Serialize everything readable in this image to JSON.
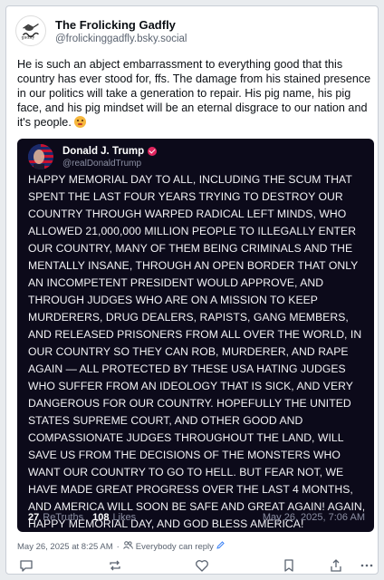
{
  "author": {
    "display_name": "The Frolicking Gadfly",
    "handle": "@frolickinggadfly.bsky.social",
    "avatar_icon": "gadfly-logo"
  },
  "post": {
    "text": "He is such an abject embarrassment to everything good that this country has ever stood for, ffs. The damage from his stained presence in our politics will take a generation to repair. His pig name, his pig face, and his pig mindset will be an eternal disgrace to our nation and it's people.",
    "emoji": "grimacing-face"
  },
  "quote": {
    "display_name": "Donald J. Trump",
    "handle": "@realDonaldTrump",
    "text": "HAPPY MEMORIAL DAY TO ALL, INCLUDING THE SCUM THAT SPENT THE LAST FOUR YEARS TRYING TO DESTROY OUR COUNTRY THROUGH WARPED RADICAL LEFT MINDS, WHO ALLOWED 21,000,000 MILLION PEOPLE TO ILLEGALLY ENTER OUR COUNTRY, MANY OF THEM BEING CRIMINALS AND THE MENTALLY INSANE, THROUGH AN OPEN BORDER THAT ONLY AN INCOMPETENT PRESIDENT WOULD APPROVE, AND THROUGH JUDGES WHO ARE ON A MISSION TO KEEP MURDERERS, DRUG DEALERS, RAPISTS, GANG MEMBERS, AND RELEASED PRISONERS FROM ALL OVER THE WORLD, IN OUR COUNTRY SO THEY CAN ROB, MURDERER, AND RAPE AGAIN — ALL PROTECTED BY THESE USA HATING JUDGES WHO SUFFER FROM AN IDEOLOGY THAT IS SICK, AND VERY DANGEROUS FOR OUR COUNTRY. HOPEFULLY THE UNITED STATES SUPREME COURT, AND OTHER GOOD AND COMPASSIONATE JUDGES THROUGHOUT THE LAND, WILL SAVE US FROM THE DECISIONS OF THE MONSTERS WHO WANT OUR COUNTRY TO GO TO HELL. BUT FEAR NOT, WE HAVE MADE GREAT PROGRESS OVER THE LAST 4 MONTHS, AND AMERICA WILL SOON BE SAFE AND GREAT AGAIN! AGAIN, HAPPY MEMORIAL DAY, AND GOD BLESS AMERICA!",
    "retruths_count": "27",
    "retruths_label": "ReTruths",
    "likes_count": "108",
    "likes_label": "Likes",
    "date": "May 26, 2025, 7:06 AM"
  },
  "meta": {
    "timestamp": "May 26, 2025 at 8:25 AM",
    "separator": "·",
    "reply_setting": "Everybody can reply"
  },
  "actions": [
    {
      "icon": "reply-icon"
    },
    {
      "icon": "repost-icon"
    },
    {
      "icon": "like-icon"
    },
    {
      "icon": "bookmark-icon"
    },
    {
      "icon": "share-icon"
    },
    {
      "icon": "more-icon"
    }
  ],
  "colors": {
    "quote_background": "#0c0a1a",
    "verified_badge": "#e0245e",
    "link_blue": "#3b82f6"
  }
}
